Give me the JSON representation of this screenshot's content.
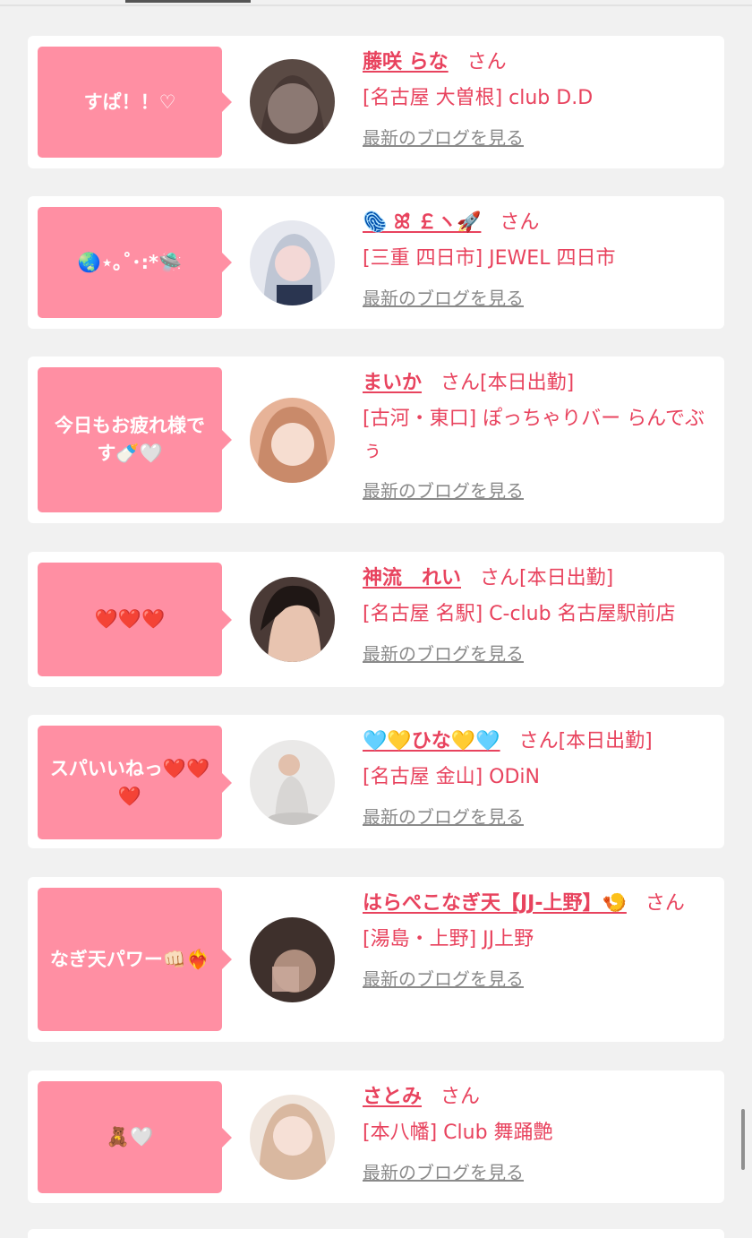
{
  "entries": [
    {
      "message": "すぱ！！♡",
      "name": "藤咲 らな",
      "honorific": "さん",
      "status": "",
      "shop": "[名古屋 大曽根] club D.D",
      "blog_link": "最新のブログを見る",
      "avatar_color": "#5a4a44"
    },
    {
      "message": "🌏⋆｡˚･:*🛸",
      "name": "🫆 ꕤ̊ ￡ヽ🚀",
      "honorific": "さん",
      "status": "",
      "shop": "[三重 四日市] JEWEL 四日市",
      "blog_link": "最新のブログを見る",
      "avatar_color": "#bfc6d4"
    },
    {
      "message": "今日もお疲れ様です🍼🤍",
      "name": "まいか",
      "honorific": "さん",
      "status": "[本日出勤]",
      "shop": "[古河・東口] ぽっちゃりバー らんでぶぅ",
      "blog_link": "最新のブログを見る",
      "avatar_color": "#c98a6a"
    },
    {
      "message": "❤️❤️❤️",
      "name": "神流　れい",
      "honorific": "さん",
      "status": "[本日出勤]",
      "shop": "[名古屋 名駅] C-club 名古屋駅前店",
      "blog_link": "最新のブログを見る",
      "avatar_color": "#4a3a36"
    },
    {
      "message": "スパいいねっ❤️❤️❤️",
      "name": "🩵💛ひな💛🩵",
      "honorific": "さん",
      "status": "[本日出勤]",
      "shop": "[名古屋 金山] ODiN",
      "blog_link": "最新のブログを見る",
      "avatar_color": "#d8d6d4"
    },
    {
      "message": "なぎ天パワー👊🏻❤️‍🔥",
      "name": "はらぺこなぎ天【JJ-上野】🍤",
      "honorific": "さん",
      "status": "",
      "shop": "[湯島・上野] JJ上野",
      "blog_link": "最新のブログを見る",
      "avatar_color": "#3e302c"
    },
    {
      "message": "🧸🤍",
      "name": "さとみ",
      "honorific": "さん",
      "status": "",
      "shop": "[本八幡] Club 舞踊艶",
      "blog_link": "最新のブログを見る",
      "avatar_color": "#d9b8a0"
    }
  ]
}
